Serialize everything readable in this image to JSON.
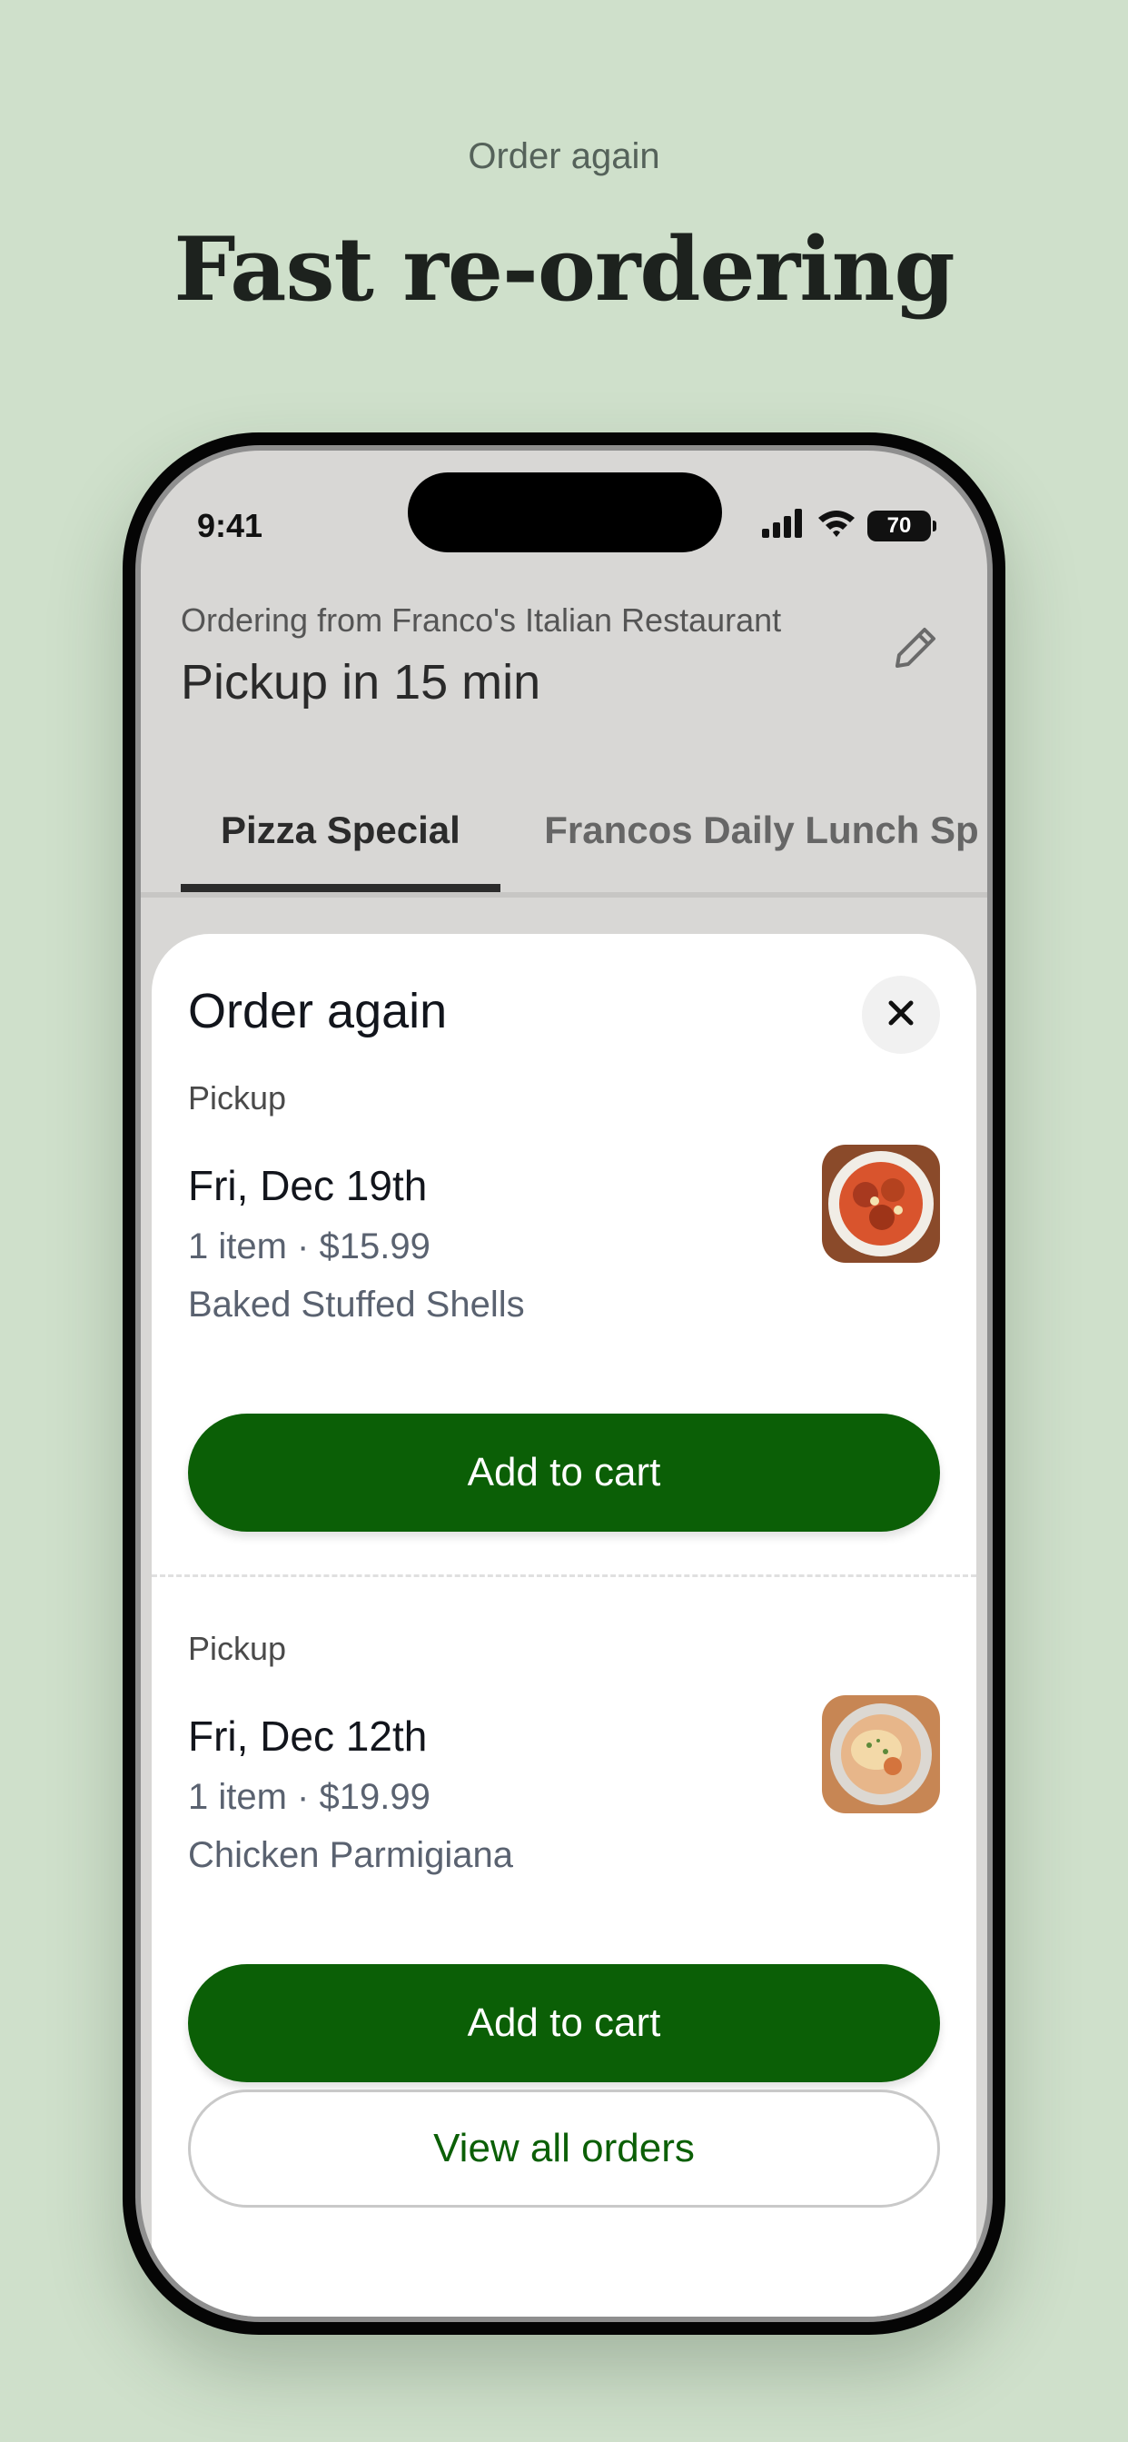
{
  "hero": {
    "eyebrow": "Order again",
    "headline": "Fast re-ordering"
  },
  "status_bar": {
    "time": "9:41",
    "battery": "70"
  },
  "header": {
    "ordering_from": "Ordering from Franco's Italian Restaurant",
    "pickup_time": "Pickup in 15 min"
  },
  "tabs": [
    {
      "label": "Pizza Special",
      "active": true
    },
    {
      "label": "Francos Daily Lunch Sp",
      "active": false
    }
  ],
  "sheet": {
    "title": "Order again",
    "orders": [
      {
        "type": "Pickup",
        "date": "Fri, Dec 19th",
        "meta": "1 item · $15.99",
        "item": "Baked Stuffed Shells",
        "button": "Add to cart"
      },
      {
        "type": "Pickup",
        "date": "Fri, Dec 12th",
        "meta": "1 item · $19.99",
        "item": "Chicken Parmigiana",
        "button": "Add to cart"
      }
    ],
    "view_all": "View all orders"
  },
  "colors": {
    "background": "#cfe0cb",
    "primary_green": "#0b5f06"
  }
}
